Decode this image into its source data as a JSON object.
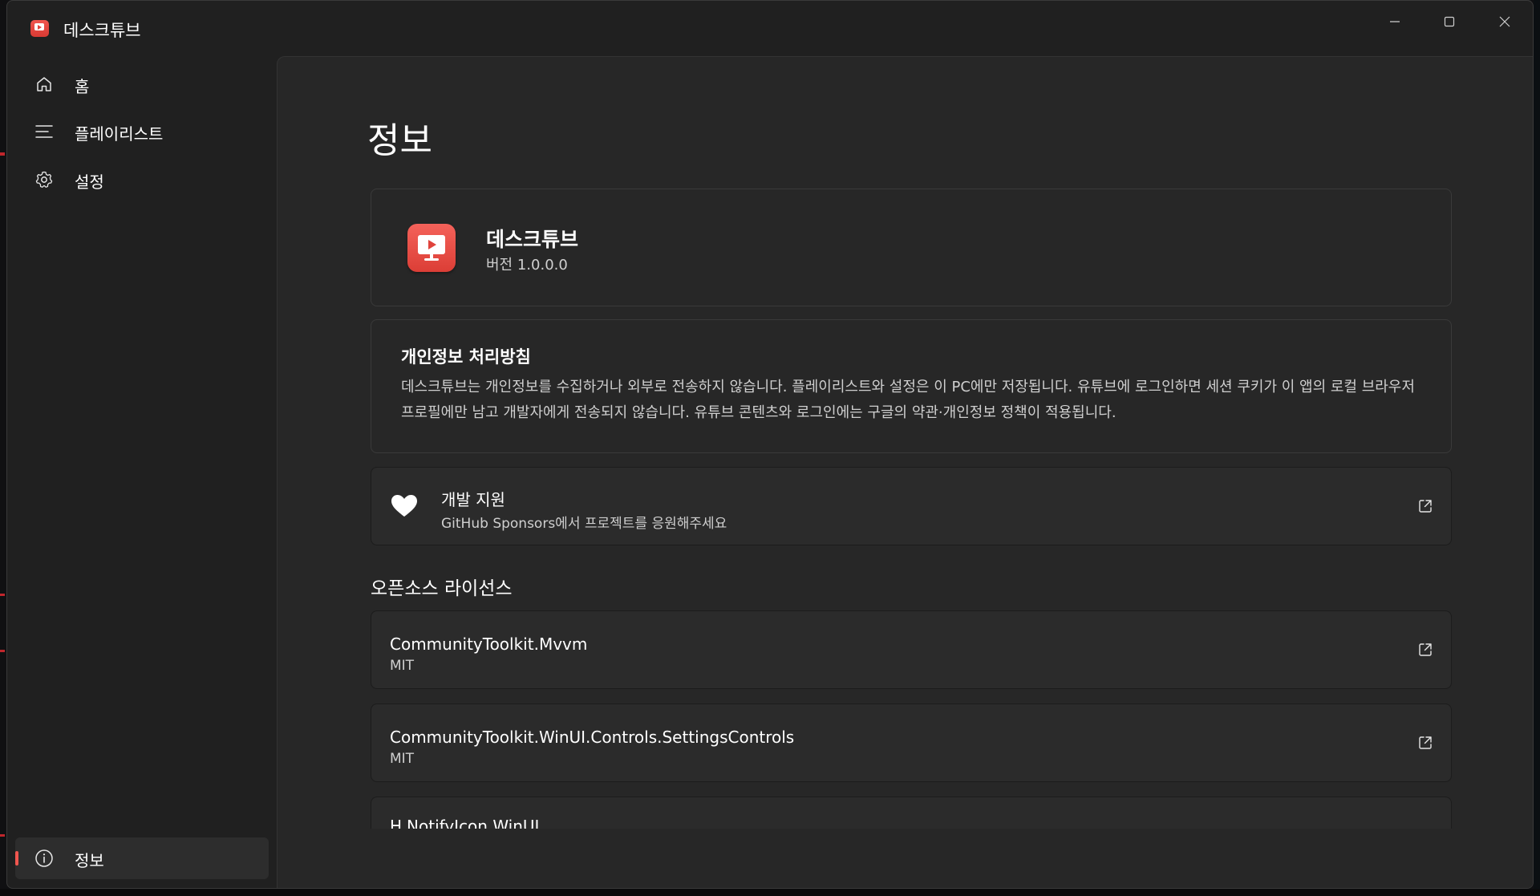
{
  "app": {
    "title": "데스크튜브",
    "brand_color": "#E8453E",
    "accent_color": "#F0564F"
  },
  "window_controls": {
    "minimize_icon": "minimize-icon",
    "maximize_icon": "maximize-icon",
    "close_icon": "close-icon"
  },
  "nav": {
    "items": [
      {
        "label": "홈",
        "icon": "home-icon"
      },
      {
        "label": "플레이리스트",
        "icon": "list-icon"
      },
      {
        "label": "설정",
        "icon": "gear-icon"
      }
    ],
    "footer_item": {
      "label": "정보",
      "icon": "info-icon",
      "selected": true
    }
  },
  "page": {
    "title": "정보",
    "about_card": {
      "app_name": "데스크튜브",
      "version": "버전 1.0.0.0"
    },
    "privacy": {
      "heading": "개인정보 처리방침",
      "body": "데스크튜브는 개인정보를 수집하거나 외부로 전송하지 않습니다. 플레이리스트와 설정은 이 PC에만 저장됩니다. 유튜브에 로그인하면 세션 쿠키가 이 앱의 로컬 브라우저 프로필에만 남고 개발자에게 전송되지 않습니다. 유튜브 콘텐츠와 로그인에는 구글의 약관·개인정보 정책이 적용됩니다."
    },
    "support": {
      "title": "개발 지원",
      "subtitle": "GitHub Sponsors에서 프로젝트를 응원해주세요",
      "icon": "heart-icon"
    },
    "licenses": {
      "section_title": "오픈소스 라이선스",
      "items": [
        {
          "name": "CommunityToolkit.Mvvm",
          "license": "MIT"
        },
        {
          "name": "CommunityToolkit.WinUI.Controls.SettingsControls",
          "license": "MIT"
        },
        {
          "name": "H.NotifyIcon.WinUI",
          "license": ""
        }
      ]
    }
  }
}
